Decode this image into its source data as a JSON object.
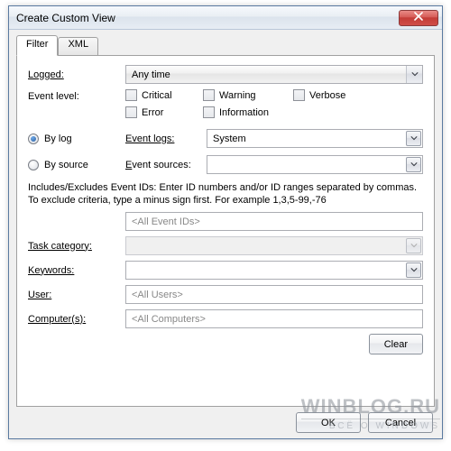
{
  "window": {
    "title": "Create Custom View"
  },
  "tabs": {
    "filter": "Filter",
    "xml": "XML"
  },
  "labels": {
    "logged": "Logged:",
    "event_level": "Event level:",
    "by_log": "By log",
    "by_source": "By source",
    "event_logs": "Event logs:",
    "event_sources": "Event sources:",
    "help": "Includes/Excludes Event IDs: Enter ID numbers and/or ID ranges separated by commas. To exclude criteria, type a minus sign first. For example 1,3,5-99,-76",
    "task_category": "Task category:",
    "keywords": "Keywords:",
    "user": "User:",
    "computers": "Computer(s):"
  },
  "values": {
    "logged": "Any time",
    "event_logs": "System",
    "event_sources": "",
    "event_ids_placeholder": "<All Event IDs>",
    "task_category": "",
    "keywords": "",
    "user_placeholder": "<All Users>",
    "computers_placeholder": "<All Computers>"
  },
  "checkboxes": {
    "critical": "Critical",
    "warning": "Warning",
    "verbose": "Verbose",
    "error": "Error",
    "information": "Information"
  },
  "buttons": {
    "clear": "Clear",
    "ok": "OK",
    "cancel": "Cancel"
  },
  "radio": {
    "selected": "by_log"
  },
  "watermark": {
    "line1": "WINBLOG.RU",
    "line2": "ВСЁ О WINDOWS"
  }
}
